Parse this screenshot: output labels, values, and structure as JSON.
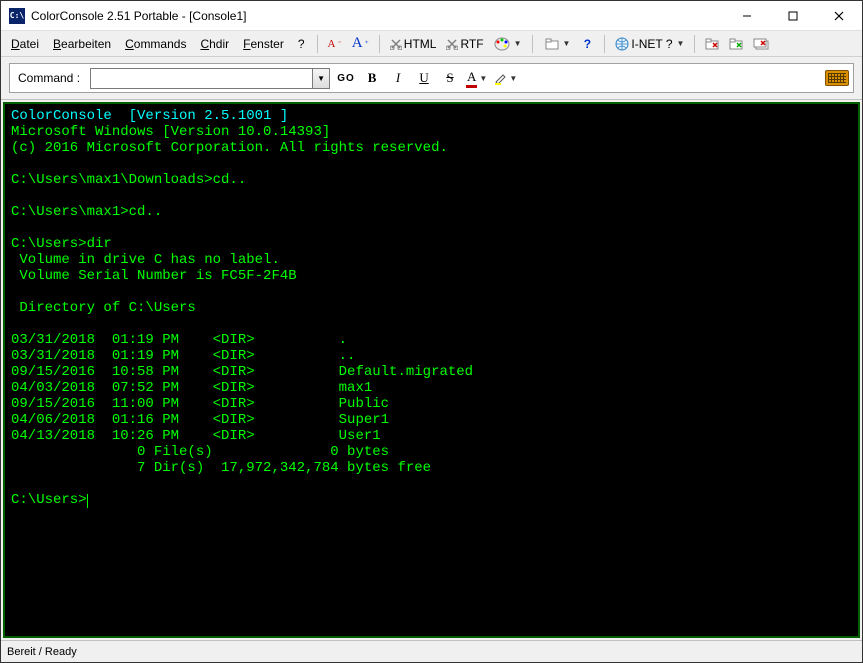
{
  "window": {
    "title": "ColorConsole 2.51 Portable - [Console1]",
    "app_icon_text": "C:\\"
  },
  "menu": {
    "datei": "Datei",
    "bearbeiten": "Bearbeiten",
    "commands": "Commands",
    "chdir": "Chdir",
    "fenster": "Fenster",
    "help": "?",
    "font_dec": "A",
    "font_inc": "A",
    "html": "HTML",
    "rtf": "RTF",
    "inet": "I-NET ?"
  },
  "cmdbar": {
    "label": "Command :",
    "value": "",
    "go": "GO",
    "bold": "B",
    "italic": "I",
    "underline": "U",
    "strike": "S",
    "fontcolor": "A"
  },
  "terminal": {
    "lines": [
      {
        "text": "ColorConsole  [Version 2.5.1001 ]",
        "cls": "cyan"
      },
      {
        "text": "Microsoft Windows [Version 10.0.14393]",
        "cls": ""
      },
      {
        "text": "(c) 2016 Microsoft Corporation. All rights reserved.",
        "cls": ""
      },
      {
        "text": "",
        "cls": ""
      },
      {
        "text": "C:\\Users\\max1\\Downloads>cd..",
        "cls": ""
      },
      {
        "text": "",
        "cls": ""
      },
      {
        "text": "C:\\Users\\max1>cd..",
        "cls": ""
      },
      {
        "text": "",
        "cls": ""
      },
      {
        "text": "C:\\Users>dir",
        "cls": ""
      },
      {
        "text": " Volume in drive C has no label.",
        "cls": ""
      },
      {
        "text": " Volume Serial Number is FC5F-2F4B",
        "cls": ""
      },
      {
        "text": "",
        "cls": ""
      },
      {
        "text": " Directory of C:\\Users",
        "cls": ""
      },
      {
        "text": "",
        "cls": ""
      },
      {
        "text": "03/31/2018  01:19 PM    <DIR>          .",
        "cls": ""
      },
      {
        "text": "03/31/2018  01:19 PM    <DIR>          ..",
        "cls": ""
      },
      {
        "text": "09/15/2016  10:58 PM    <DIR>          Default.migrated",
        "cls": ""
      },
      {
        "text": "04/03/2018  07:52 PM    <DIR>          max1",
        "cls": ""
      },
      {
        "text": "09/15/2016  11:00 PM    <DIR>          Public",
        "cls": ""
      },
      {
        "text": "04/06/2018  01:16 PM    <DIR>          Super1",
        "cls": ""
      },
      {
        "text": "04/13/2018  10:26 PM    <DIR>          User1",
        "cls": ""
      },
      {
        "text": "               0 File(s)              0 bytes",
        "cls": ""
      },
      {
        "text": "               7 Dir(s)  17,972,342,784 bytes free",
        "cls": ""
      },
      {
        "text": "",
        "cls": ""
      }
    ],
    "prompt": "C:\\Users>"
  },
  "status": {
    "text": "Bereit / Ready"
  }
}
